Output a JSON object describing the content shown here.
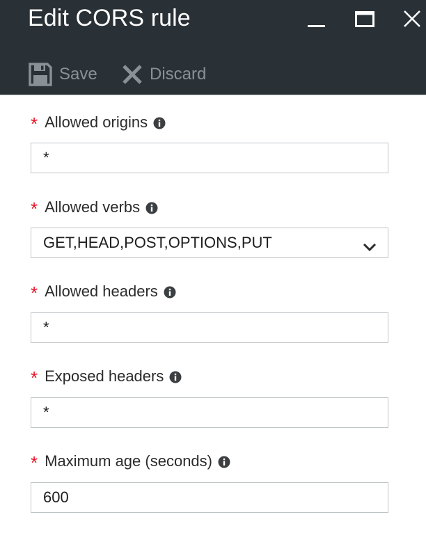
{
  "blade": {
    "title": "Edit CORS rule"
  },
  "toolbar": {
    "save_label": "Save",
    "discard_label": "Discard"
  },
  "fields": {
    "allowed_origins": {
      "label": "Allowed origins",
      "required_marker": "*",
      "value": "*"
    },
    "allowed_verbs": {
      "label": "Allowed verbs",
      "required_marker": "*",
      "value": "GET,HEAD,POST,OPTIONS,PUT"
    },
    "allowed_headers": {
      "label": "Allowed headers",
      "required_marker": "*",
      "value": "*"
    },
    "exposed_headers": {
      "label": "Exposed headers",
      "required_marker": "*",
      "value": "*"
    },
    "max_age": {
      "label": "Maximum age (seconds)",
      "required_marker": "*",
      "value": "600"
    }
  },
  "icons": {
    "save": "floppy-disk-icon",
    "discard": "x-icon",
    "info": "info-icon",
    "dropdown": "chevron-down-icon",
    "minimize": "minimize-icon",
    "maximize": "maximize-icon",
    "close": "close-icon"
  },
  "colors": {
    "header_bg": "#2a3136",
    "required": "#e81123",
    "toolbar_text": "#8a9196",
    "border": "#bfc4c7"
  }
}
